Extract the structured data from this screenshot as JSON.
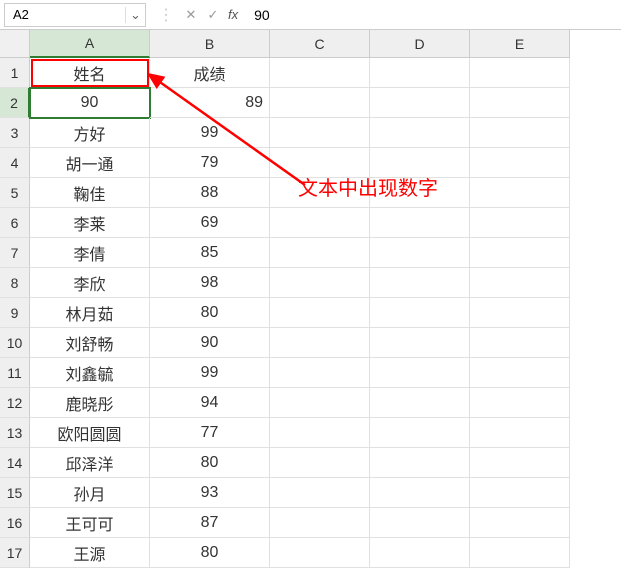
{
  "name_box": "A2",
  "formula_value": "90",
  "columns": [
    "A",
    "B",
    "C",
    "D",
    "E"
  ],
  "active_col": "A",
  "active_row": 2,
  "selected_cell": "A2",
  "headers": {
    "col_a": "姓名",
    "col_b": "成绩"
  },
  "rows": [
    {
      "n": 1,
      "a": "姓名",
      "b": "成绩",
      "a_align": "center",
      "b_align": "center"
    },
    {
      "n": 2,
      "a": "90",
      "b": "89",
      "a_align": "center",
      "b_align": "right"
    },
    {
      "n": 3,
      "a": "方好",
      "b": "99",
      "a_align": "center",
      "b_align": "center"
    },
    {
      "n": 4,
      "a": "胡一通",
      "b": "79",
      "a_align": "center",
      "b_align": "center"
    },
    {
      "n": 5,
      "a": "鞠佳",
      "b": "88",
      "a_align": "center",
      "b_align": "center"
    },
    {
      "n": 6,
      "a": "李莱",
      "b": "69",
      "a_align": "center",
      "b_align": "center"
    },
    {
      "n": 7,
      "a": "李倩",
      "b": "85",
      "a_align": "center",
      "b_align": "center"
    },
    {
      "n": 8,
      "a": "李欣",
      "b": "98",
      "a_align": "center",
      "b_align": "center"
    },
    {
      "n": 9,
      "a": "林月茹",
      "b": "80",
      "a_align": "center",
      "b_align": "center"
    },
    {
      "n": 10,
      "a": "刘舒畅",
      "b": "90",
      "a_align": "center",
      "b_align": "center"
    },
    {
      "n": 11,
      "a": "刘鑫毓",
      "b": "99",
      "a_align": "center",
      "b_align": "center"
    },
    {
      "n": 12,
      "a": "鹿晓彤",
      "b": "94",
      "a_align": "center",
      "b_align": "center"
    },
    {
      "n": 13,
      "a": "欧阳圆圆",
      "b": "77",
      "a_align": "center",
      "b_align": "center"
    },
    {
      "n": 14,
      "a": "邱泽洋",
      "b": "80",
      "a_align": "center",
      "b_align": "center"
    },
    {
      "n": 15,
      "a": "孙月",
      "b": "93",
      "a_align": "center",
      "b_align": "center"
    },
    {
      "n": 16,
      "a": "王可可",
      "b": "87",
      "a_align": "center",
      "b_align": "center"
    },
    {
      "n": 17,
      "a": "王源",
      "b": "80",
      "a_align": "center",
      "b_align": "center"
    }
  ],
  "annotation_text": "文本中出现数字",
  "colors": {
    "annotation": "#ff0000",
    "selection": "#2e7d32"
  }
}
